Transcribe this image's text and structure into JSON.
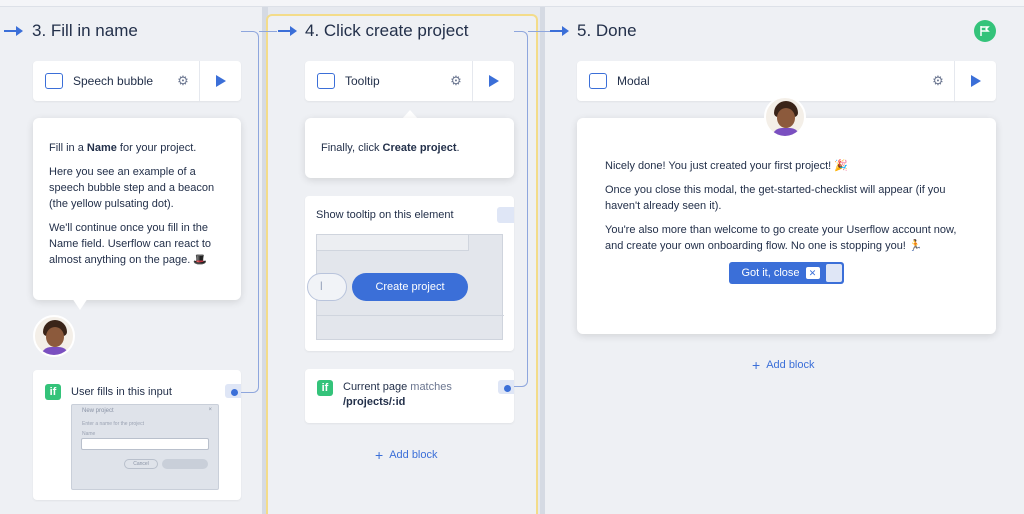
{
  "columns": {
    "c3": {
      "title": "3. Fill in name"
    },
    "c4": {
      "title": "4. Click create project"
    },
    "c5": {
      "title": "5. Done"
    }
  },
  "step3": {
    "label": "Speech bubble",
    "bubble": {
      "p1_pre": "Fill in a ",
      "p1_bold": "Name",
      "p1_post": " for your project.",
      "p2": "Here you see an example of a speech bubble step and a beacon (the yellow pulsating dot).",
      "p3": "We'll continue once you fill in the Name field. Userflow can react to almost anything on the page. 🎩"
    },
    "trigger": {
      "badge": "if",
      "text": "User fills in this input",
      "thumb_title": "New project",
      "thumb_hint": "Enter a name for the project",
      "thumb_field_label": "Name",
      "thumb_cancel": "Cancel"
    }
  },
  "step4": {
    "label": "Tooltip",
    "bubble_pre": "Finally, click ",
    "bubble_bold": "Create project",
    "bubble_post": ".",
    "target_label": "Show tooltip on this element",
    "preview_button": "Create project",
    "preview_partial": "l",
    "trigger": {
      "badge": "if",
      "text_pre": "Current page",
      "text_muted": " matches",
      "path": "/projects/:id"
    },
    "add_block": "Add block"
  },
  "step5": {
    "label": "Modal",
    "p1": "Nicely done! You just created your first project! 🎉",
    "p2": "Once you close this modal, the get-started-checklist will appear (if you haven't already seen it).",
    "p3": "You're also more than welcome to go create your Userflow account now, and create your own onboarding flow. No one is stopping you! 🏃",
    "button": "Got it, close",
    "add_block": "Add block"
  },
  "colors": {
    "accent": "#3b6fd8",
    "success": "#34c37a",
    "highlight": "#f3dc8a"
  }
}
